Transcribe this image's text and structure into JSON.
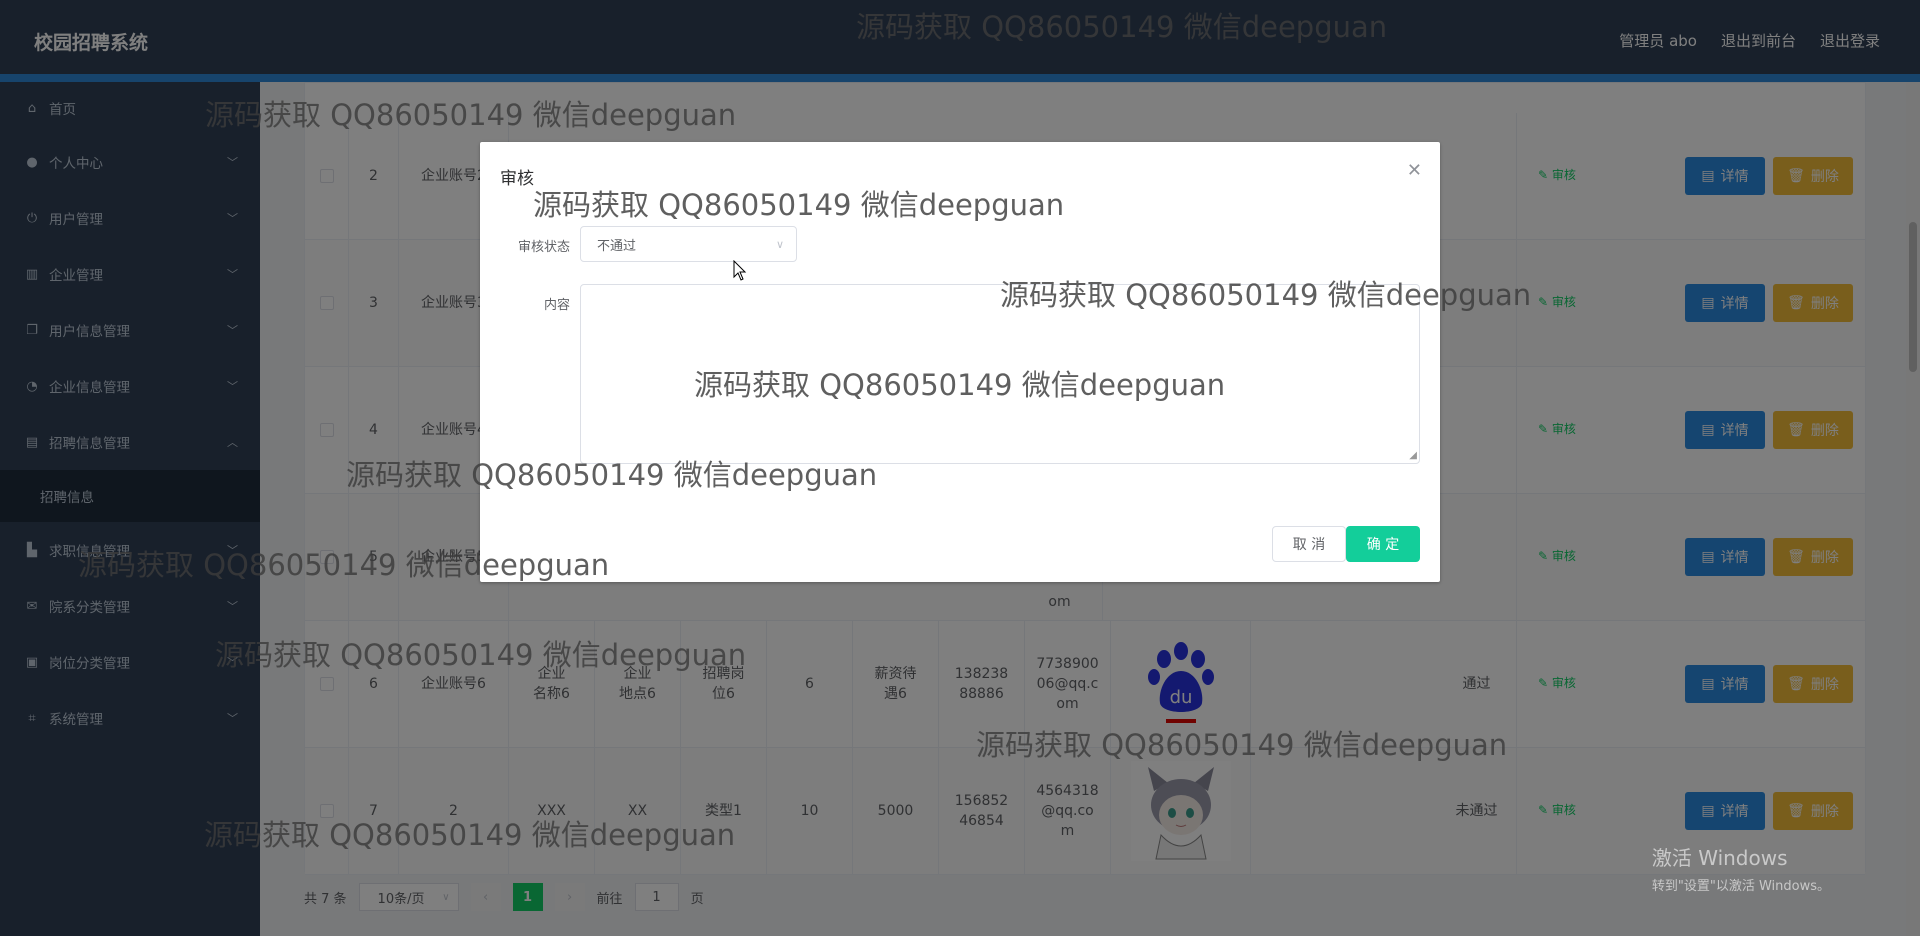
{
  "app": {
    "title": "校园招聘系统",
    "header_links": [
      "管理员 abo",
      "退出到前台",
      "退出登录"
    ]
  },
  "sidebar": {
    "items": [
      {
        "label": "首页",
        "icon": "home-icon"
      },
      {
        "label": "个人中心",
        "icon": "user-icon"
      },
      {
        "label": "用户管理",
        "icon": "power-icon"
      },
      {
        "label": "企业管理",
        "icon": "chart-icon"
      },
      {
        "label": "用户信息管理",
        "icon": "copy-icon"
      },
      {
        "label": "企业信息管理",
        "icon": "gauge-icon"
      },
      {
        "label": "招聘信息管理",
        "icon": "trash-icon"
      },
      {
        "label": "求职信息管理",
        "icon": "stamp-icon"
      },
      {
        "label": "院系分类管理",
        "icon": "mail-icon"
      },
      {
        "label": "岗位分类管理",
        "icon": "clipboard-icon"
      },
      {
        "label": "系统管理",
        "icon": "crop-icon"
      }
    ],
    "submenu": {
      "label": "招聘信息"
    }
  },
  "table": {
    "rows": [
      {
        "index": "2",
        "account": "企业账号2",
        "company": "",
        "location": "",
        "position": "",
        "count": "",
        "salary": "",
        "phone": "",
        "email": "",
        "status": ""
      },
      {
        "index": "3",
        "account": "企业账号3",
        "company": "",
        "location": "",
        "position": "",
        "count": "",
        "salary": "",
        "phone": "",
        "email": "",
        "status": ""
      },
      {
        "index": "4",
        "account": "企业账号4",
        "company": "",
        "location": "",
        "position": "",
        "count": "",
        "salary": "",
        "phone": "",
        "email": "",
        "status": ""
      },
      {
        "index": "5",
        "account": "企业账号5",
        "company": "",
        "location": "",
        "position": "",
        "count": "",
        "salary": "",
        "phone": "",
        "email": "om",
        "status": ""
      },
      {
        "index": "6",
        "account": "企业账号6",
        "company": "企业名称6",
        "location": "企业地点6",
        "position": "招聘岗位6",
        "count": "6",
        "salary": "薪资待遇6",
        "phone": "13823888886",
        "email": "773890006@qq.com",
        "status": "通过"
      },
      {
        "index": "7",
        "account": "2",
        "company": "XXX",
        "location": "XX",
        "position": "类型1",
        "count": "10",
        "salary": "5000",
        "phone": "15685246854",
        "email": "4564318@qq.com",
        "status": "未通过"
      }
    ],
    "audit_label": "审核",
    "detail_label": "详情",
    "delete_label": "删除"
  },
  "pagination": {
    "total": "共 7 条",
    "page_size": "10条/页",
    "current_page": "1",
    "goto_prefix": "前往",
    "goto_value": "1",
    "goto_suffix": "页"
  },
  "dialog": {
    "title": "审核",
    "status_label": "审核状态",
    "status_value": "不通过",
    "content_label": "内容",
    "content_value": "",
    "cancel_label": "取 消",
    "confirm_label": "确 定"
  },
  "watermark": "源码获取 QQ86050149 微信deepguan",
  "windows_activation": {
    "line1": "激活 Windows",
    "line2": "转到\"设置\"以激活 Windows。"
  },
  "colors": {
    "header_bg": "#304156",
    "accent_bar": "#2f88d8",
    "detail_button": "#2a8be0",
    "delete_button": "#f2bc39",
    "confirm_button": "#13ce9a",
    "pagination_active": "#13ce66"
  }
}
